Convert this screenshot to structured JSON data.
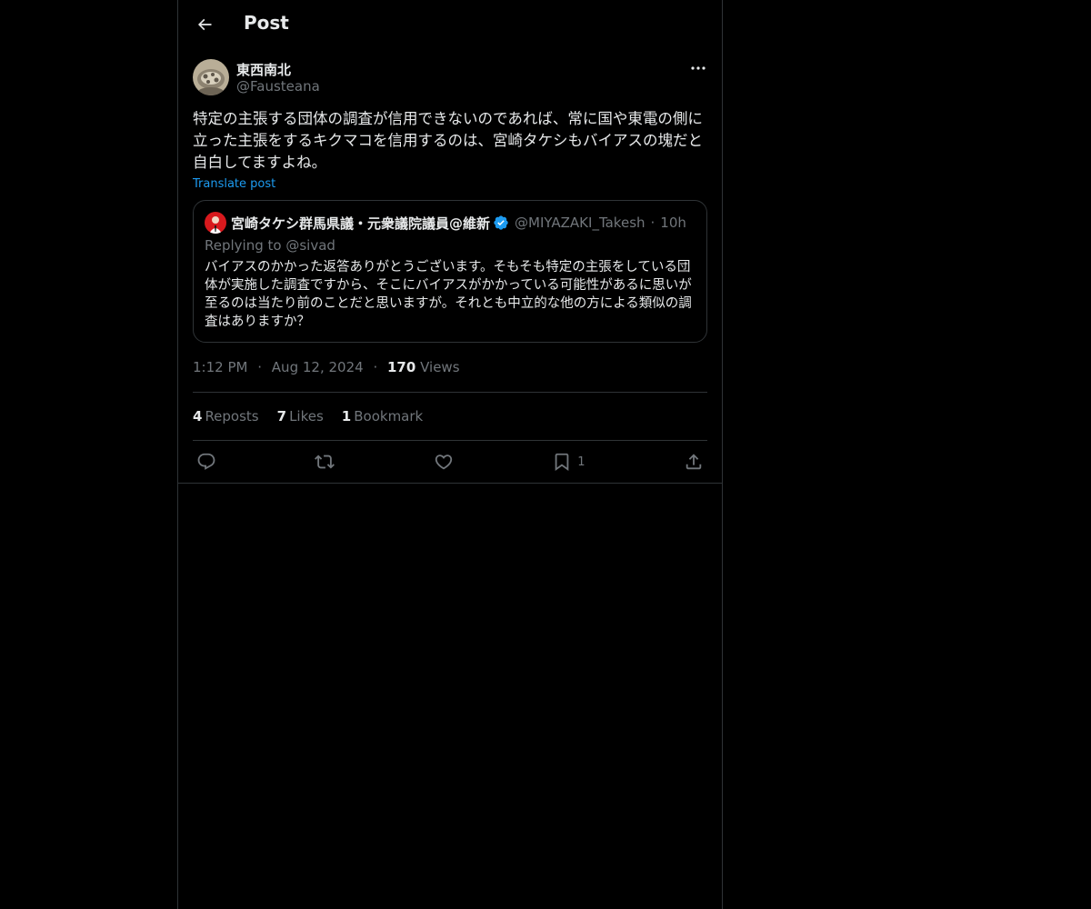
{
  "header": {
    "title": "Post"
  },
  "author": {
    "name": "東西南北",
    "handle": "@Fausteana"
  },
  "post": {
    "text": "特定の主張する団体の調査が信用できないのであれば、常に国や東電の側に立った主張をするキクマコを信用するのは、宮崎タケシもバイアスの塊だと自白してますよね。",
    "translate_label": "Translate post"
  },
  "quote": {
    "name": "宮崎タケシ群馬県議・元衆議院議員@維新",
    "handle": "@MIYAZAKI_Takesh",
    "dot": "·",
    "time": "10h",
    "replying_to": "Replying to @sivad",
    "text": "バイアスのかかった返答ありがとうございます。そもそも特定の主張をしている団体が実施した調査ですから、そこにバイアスがかかっている可能性があるに思いが至るのは当たり前のことだと思いますが。それとも中立的な他の方による類似の調査はありますか？"
  },
  "meta": {
    "time": "1:12 PM",
    "dot": "·",
    "date": "Aug 12, 2024",
    "views_count": "170",
    "views_label": "Views"
  },
  "stats": {
    "reposts_count": "4",
    "reposts_label": "Reposts",
    "likes_count": "7",
    "likes_label": "Likes",
    "bookmarks_count": "1",
    "bookmarks_label": "Bookmark"
  },
  "actions": {
    "bookmark_count": "1"
  },
  "colors": {
    "background": "#000000",
    "text": "#e7e9ea",
    "muted": "#71767b",
    "accent": "#1d9bf0",
    "border": "#2f3336"
  }
}
